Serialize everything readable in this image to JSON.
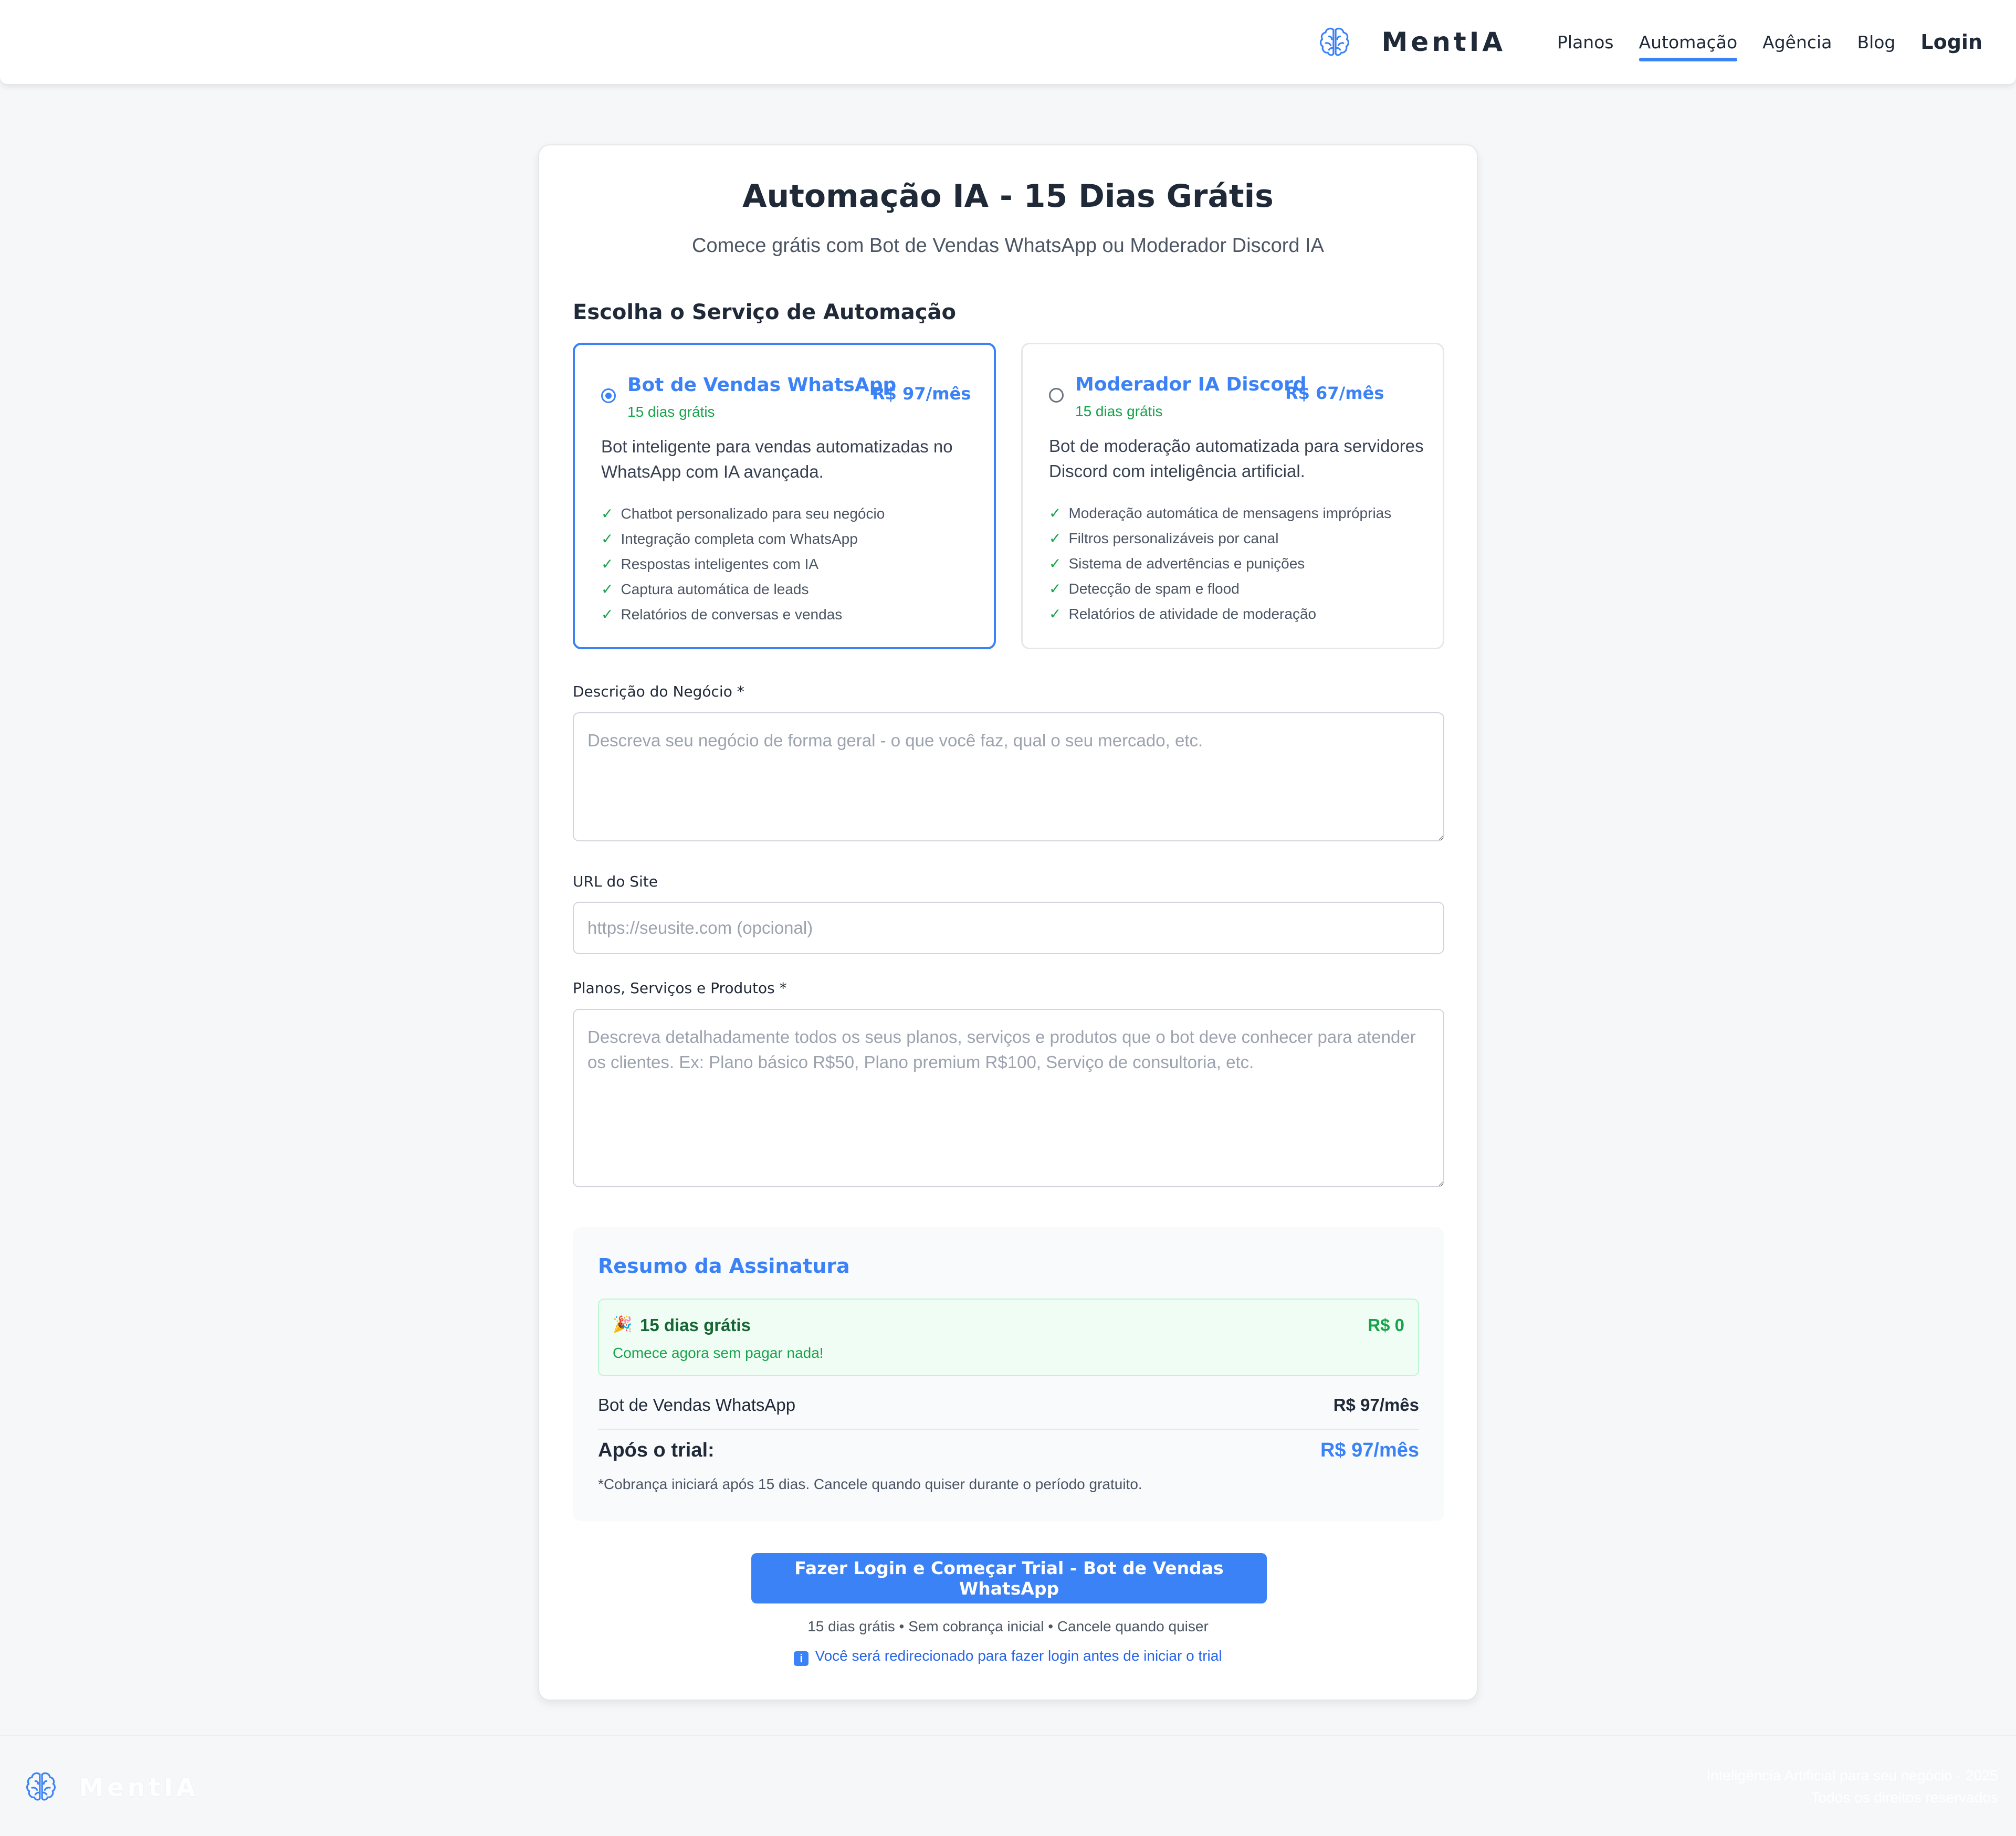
{
  "header": {
    "brand": "MentIA",
    "nav": [
      "Planos",
      "Automação",
      "Agência",
      "Blog"
    ],
    "login": "Login"
  },
  "page": {
    "title": "Automação IA - 15 Dias Grátis",
    "subtitle": "Comece grátis com Bot de Vendas WhatsApp ou Moderador Discord IA",
    "section_title": "Escolha o Serviço de Automação"
  },
  "services": [
    {
      "name": "Bot de Vendas WhatsApp",
      "price": "R$ 97/mês",
      "trial": "15 dias grátis",
      "selected": true,
      "description": "Bot inteligente para vendas automatizadas no WhatsApp com IA avançada.",
      "features": [
        "Chatbot personalizado para seu negócio",
        "Integração completa com WhatsApp",
        "Respostas inteligentes com IA",
        "Captura automática de leads",
        "Relatórios de conversas e vendas"
      ]
    },
    {
      "name": "Moderador IA Discord",
      "price": "R$ 67/mês",
      "trial": "15 dias grátis",
      "selected": false,
      "description": "Bot de moderação automatizada para servidores Discord com inteligência artificial.",
      "features": [
        "Moderação automática de mensagens impróprias",
        "Filtros personalizáveis por canal",
        "Sistema de advertências e punições",
        "Detecção de spam e flood",
        "Relatórios de atividade de moderação"
      ]
    }
  ],
  "form": {
    "business_label": "Descrição do Negócio *",
    "business_value": "",
    "business_placeholder": "Descreva seu negócio de forma geral - o que você faz, qual o seu mercado, etc.",
    "url_label": "URL do Site",
    "url_value": "",
    "url_placeholder": "https://seusite.com (opcional)",
    "plans_label": "Planos, Serviços e Produtos *",
    "plans_value": "",
    "plans_placeholder": "Descreva detalhadamente todos os seus planos, serviços e produtos que o bot deve conhecer para atender os clientes. Ex: Plano básico R$50, Plano premium R$100, Serviço de consultoria, etc."
  },
  "summary": {
    "title": "Resumo da Assinatura",
    "trial_emoji": "🎉",
    "trial_title": "15 dias grátis",
    "trial_value": "R$ 0",
    "trial_note": "Comece agora sem pagar nada!",
    "service_label": "Bot de Vendas WhatsApp",
    "service_value": "R$ 97/mês",
    "after_label": "Após o trial:",
    "after_value": "R$ 97/mês",
    "note": "*Cobrança iniciará após 15 dias. Cancele quando quiser durante o período gratuito."
  },
  "cta": {
    "label": "Fazer Login e Começar Trial - Bot de Vendas WhatsApp",
    "note": "15 dias grátis • Sem cobrança inicial • Cancele quando quiser",
    "info_icon": "i",
    "redirect_note": "Você será redirecionado para fazer login antes de iniciar o trial"
  },
  "footer": {
    "brand": "MentIA",
    "copyright": "Inteligência Artificial para seu negócio · 2025",
    "rights": "Todos os direitos reservados"
  },
  "colors": {
    "accent": "#3b82f6",
    "success": "#16a34a",
    "background": "#f6f7f8"
  },
  "icons": {
    "logo": "brain-icon",
    "check": "check-icon",
    "info": "info-icon"
  }
}
